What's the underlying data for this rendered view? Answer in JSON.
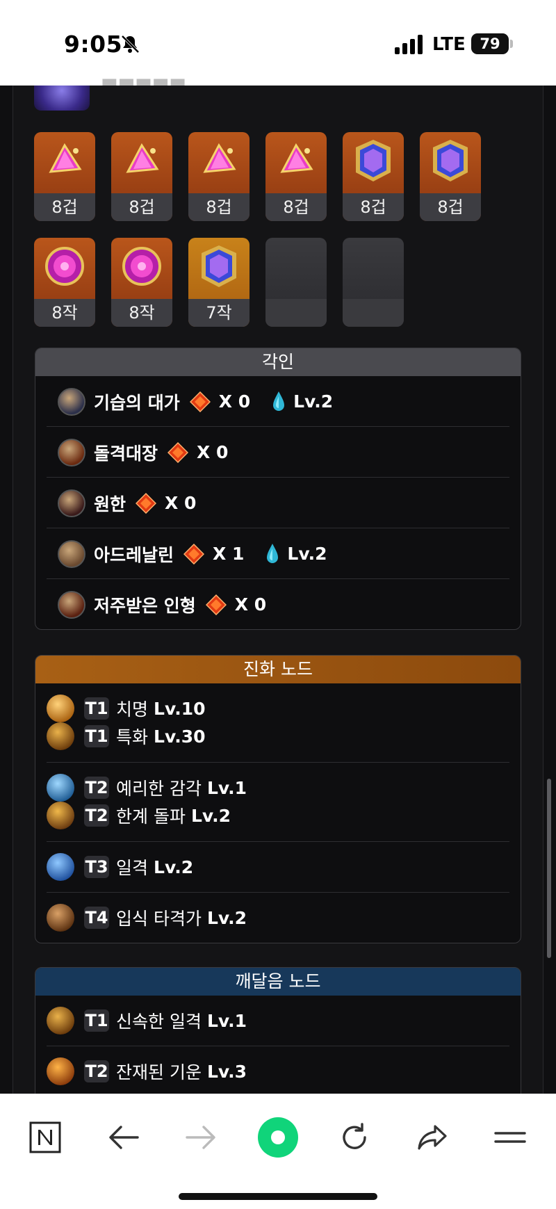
{
  "status": {
    "time": "9:05",
    "network": "LTE",
    "battery": "79"
  },
  "gems": [
    {
      "label": "8겁",
      "kind": "fire"
    },
    {
      "label": "8겁",
      "kind": "fire"
    },
    {
      "label": "8겁",
      "kind": "fire"
    },
    {
      "label": "8겁",
      "kind": "fire"
    },
    {
      "label": "8겁",
      "kind": "blue"
    },
    {
      "label": "8겁",
      "kind": "blue"
    },
    {
      "label": "8작",
      "kind": "pink"
    },
    {
      "label": "8작",
      "kind": "pink"
    },
    {
      "label": "7작",
      "kind": "blue-gold"
    }
  ],
  "engraving": {
    "title": "각인",
    "items": [
      {
        "name": "기습의 대가",
        "count": "X 0",
        "level": "Lv.2"
      },
      {
        "name": "돌격대장",
        "count": "X 0",
        "level": ""
      },
      {
        "name": "원한",
        "count": "X 0",
        "level": ""
      },
      {
        "name": "아드레날린",
        "count": "X 1",
        "level": "Lv.2"
      },
      {
        "name": "저주받은 인형",
        "count": "X 0",
        "level": ""
      }
    ]
  },
  "evolution": {
    "title": "진화 노드",
    "groups": [
      [
        {
          "tier": "T1",
          "name": "치명",
          "level": "Lv.10"
        },
        {
          "tier": "T1",
          "name": "특화",
          "level": "Lv.30"
        }
      ],
      [
        {
          "tier": "T2",
          "name": "예리한 감각",
          "level": "Lv.1"
        },
        {
          "tier": "T2",
          "name": "한계 돌파",
          "level": "Lv.2"
        }
      ],
      [
        {
          "tier": "T3",
          "name": "일격",
          "level": "Lv.2"
        }
      ],
      [
        {
          "tier": "T4",
          "name": "입식 타격가",
          "level": "Lv.2"
        }
      ]
    ]
  },
  "enlightenment": {
    "title": "깨달음 노드",
    "groups": [
      [
        {
          "tier": "T1",
          "name": "신속한 일격",
          "level": "Lv.1"
        }
      ],
      [
        {
          "tier": "T2",
          "name": "잔재된 기운",
          "level": "Lv.3"
        }
      ]
    ]
  },
  "icons": {
    "notice": "n-square-icon",
    "back": "arrow-left-icon",
    "forward": "arrow-right-icon",
    "home": "green-circle-icon",
    "reload": "reload-icon",
    "share": "share-icon",
    "menu": "menu-icon"
  },
  "colors": {
    "accent_green": "#10d47a",
    "evolution_header": "#a86015",
    "enlightenment_header": "#17385a",
    "engraving_header": "#4a4a4f"
  }
}
